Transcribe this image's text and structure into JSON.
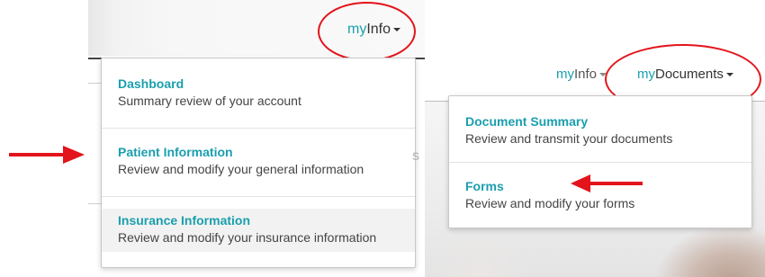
{
  "left_panel": {
    "nav": {
      "accent": "my",
      "rest": "Info"
    },
    "menu": [
      {
        "title": "Dashboard",
        "description": "Summary review of your account"
      },
      {
        "title": "Patient Information",
        "description": "Review and modify your general information"
      },
      {
        "title": "Insurance Information",
        "description": "Review and modify your insurance information"
      }
    ]
  },
  "right_panel": {
    "nav_myinfo": {
      "accent": "my",
      "rest": "Info"
    },
    "nav_mydocs": {
      "accent": "my",
      "rest": "Documents"
    },
    "menu": [
      {
        "title": "Document Summary",
        "description": "Review and transmit your documents"
      },
      {
        "title": "Forms",
        "description": "Review and modify your forms"
      }
    ],
    "background_glyph": "s"
  },
  "colors": {
    "accent": "#1a9fae",
    "annotation": "#e3141b"
  },
  "icons": {
    "caret": "caret-down-icon",
    "arrow": "red-arrow-right-icon"
  }
}
